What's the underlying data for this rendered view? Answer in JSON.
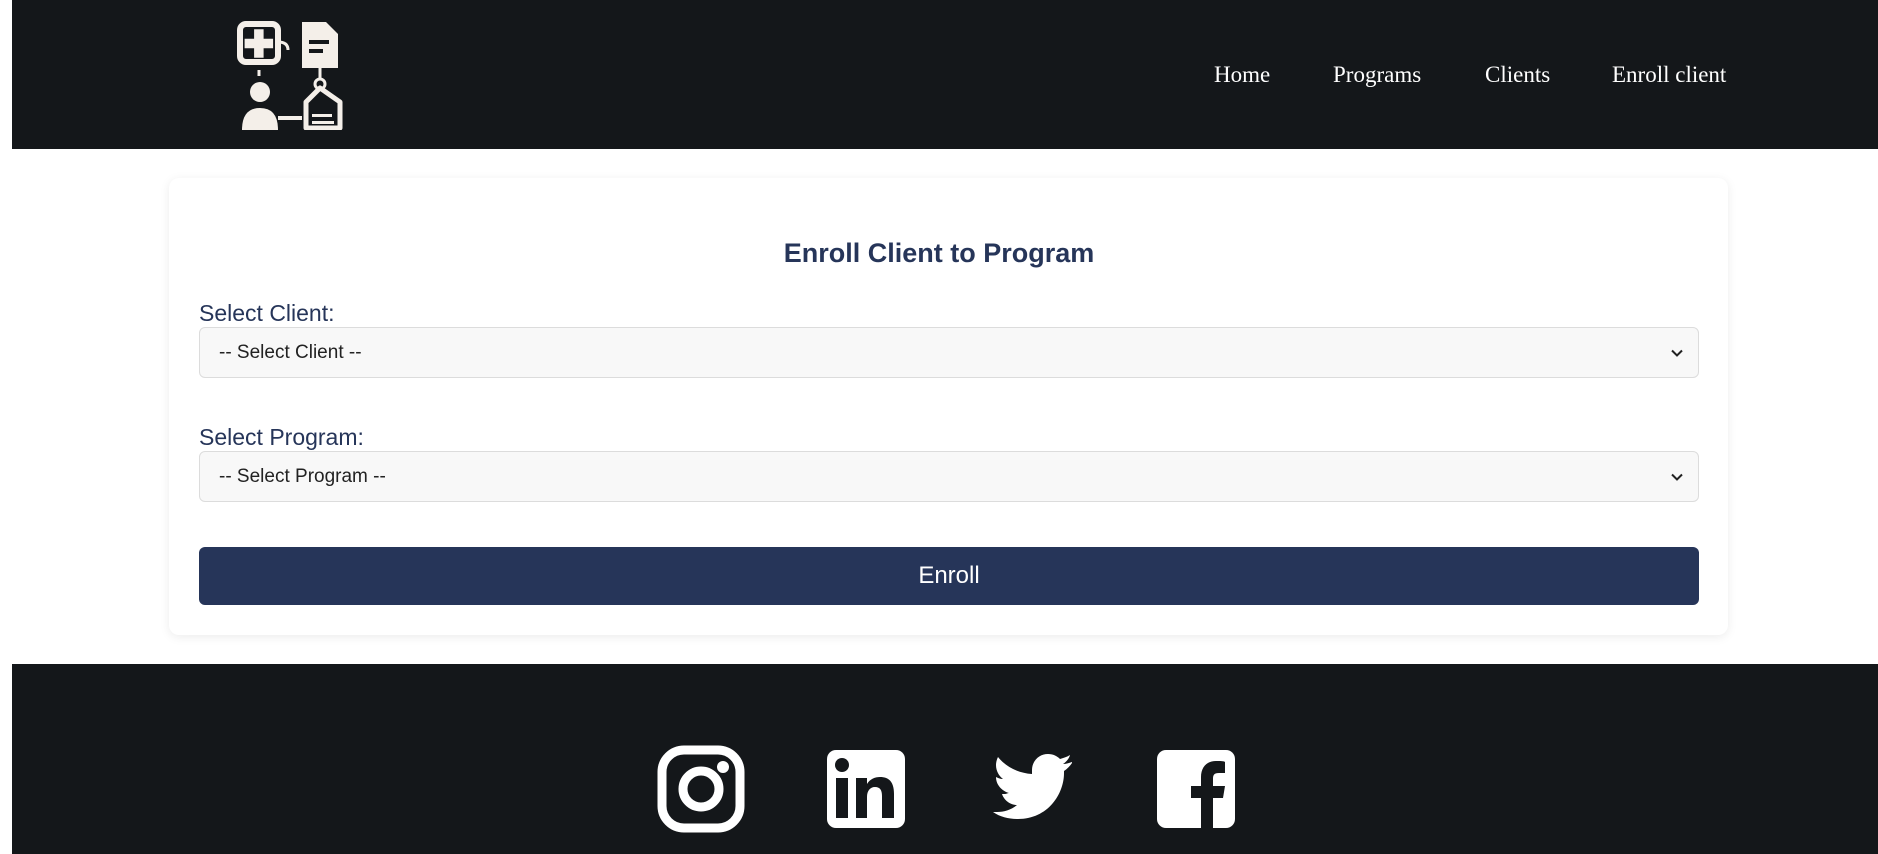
{
  "header": {
    "logo_icon": "health-records-logo-icon",
    "nav": [
      {
        "label": "Home"
      },
      {
        "label": "Programs"
      },
      {
        "label": "Clients"
      },
      {
        "label": "Enroll client"
      }
    ]
  },
  "form": {
    "title": "Enroll Client to Program",
    "client_label": "Select Client:",
    "client_selected": "-- Select Client --",
    "program_label": "Select Program:",
    "program_selected": "-- Select Program --",
    "submit_label": "Enroll"
  },
  "footer": {
    "social_icons": [
      "instagram-icon",
      "linkedin-icon",
      "twitter-icon",
      "facebook-icon"
    ]
  },
  "colors": {
    "header_bg": "#14171a",
    "accent": "#263559",
    "page_bg": "#ffffff"
  }
}
